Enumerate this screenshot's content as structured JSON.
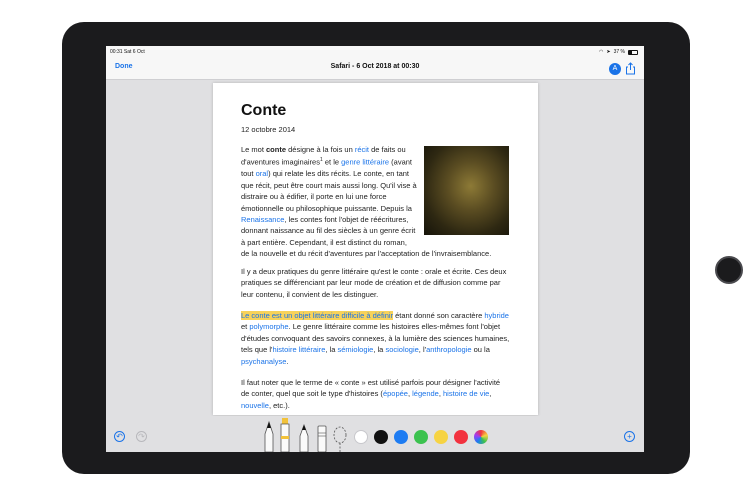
{
  "status_bar": {
    "time_date": "00:31  Sat 6 Oct",
    "battery": "37 %"
  },
  "nav": {
    "done": "Done",
    "title": "Safari - 6 Oct 2018 at 00:30",
    "markup_glyph": "A"
  },
  "document": {
    "title": "Conte",
    "date": "12 octobre 2014"
  },
  "toolbar": {
    "undo_glyph": "↶",
    "redo_glyph": "↷",
    "add_glyph": "+",
    "colors": [
      "#ffffff",
      "#111111",
      "#1e7cf2",
      "#3cc24f",
      "#f6d343",
      "#f2323f"
    ]
  }
}
